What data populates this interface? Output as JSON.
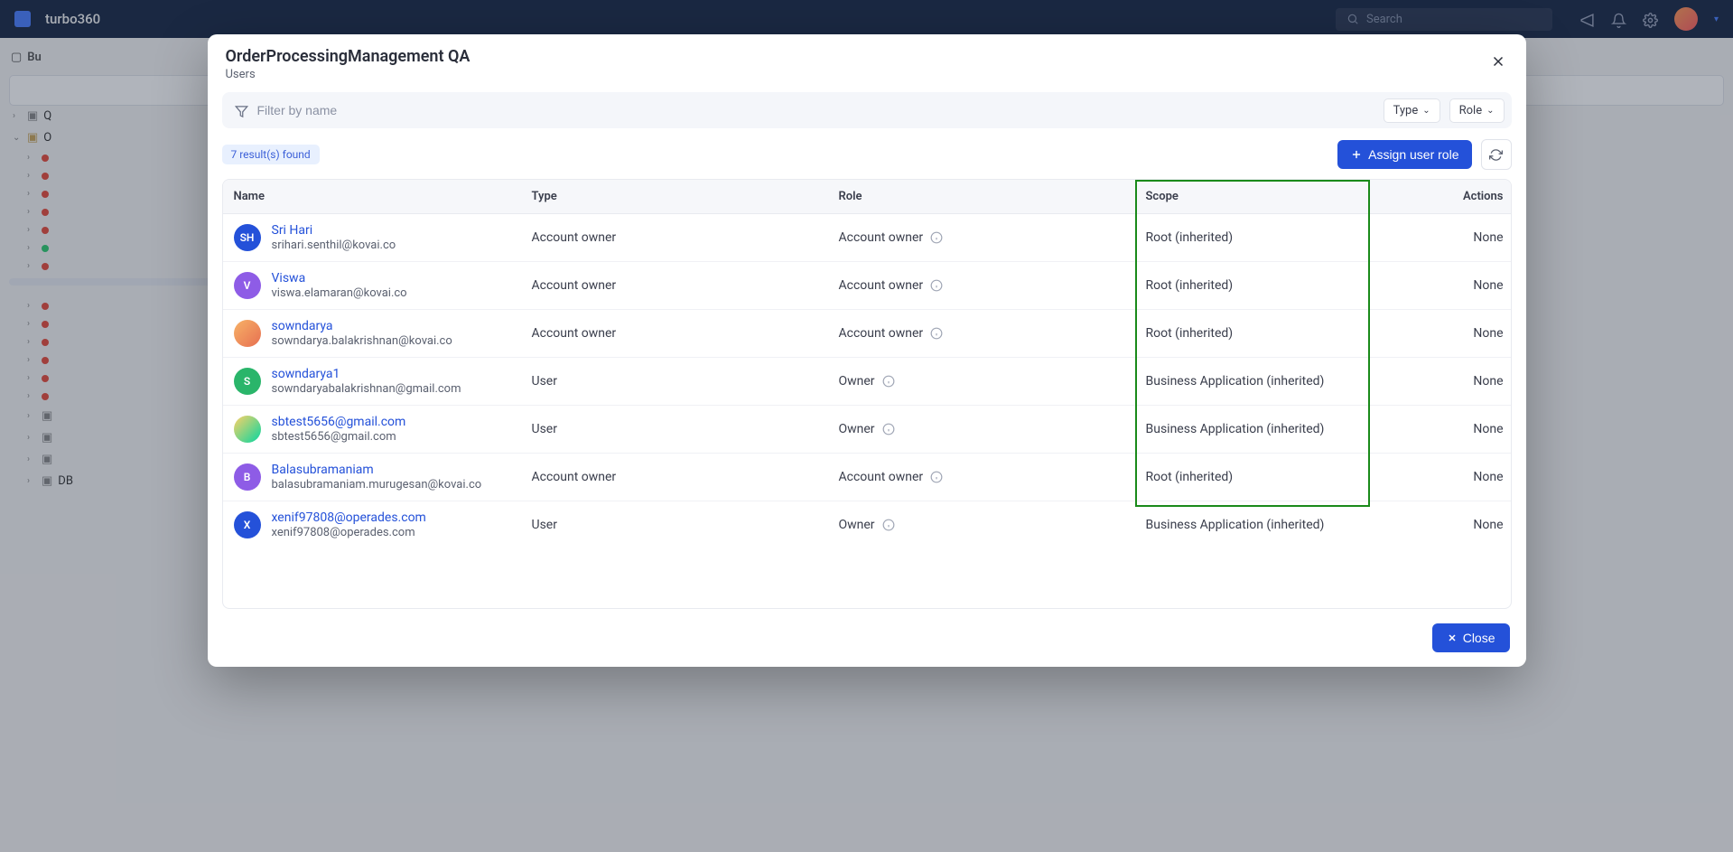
{
  "topbar": {
    "brand": "turbo360",
    "search_placeholder": "Search",
    "avatar_initials": ""
  },
  "breadcrumb": {
    "label": "Bu"
  },
  "modal": {
    "title": "OrderProcessingManagement QA",
    "subtitle": "Users",
    "filter_placeholder": "Filter by name",
    "type_dd": "Type",
    "role_dd": "Role",
    "results_badge": "7 result(s) found",
    "assign_btn": "Assign user role",
    "close_btn": "Close"
  },
  "columns": {
    "name": "Name",
    "type": "Type",
    "role": "Role",
    "scope": "Scope",
    "actions": "Actions"
  },
  "rows": [
    {
      "avatar_text": "SH",
      "avatar_bg": "#2451d9",
      "avatar_img": false,
      "name": "Sri Hari",
      "email": "srihari.senthil@kovai.co",
      "type": "Account owner",
      "role": "Account owner",
      "role_info": true,
      "scope": "Root (inherited)",
      "actions": "None"
    },
    {
      "avatar_text": "V",
      "avatar_bg": "#8e5ce6",
      "avatar_img": false,
      "name": "Viswa",
      "email": "viswa.elamaran@kovai.co",
      "type": "Account owner",
      "role": "Account owner",
      "role_info": true,
      "scope": "Root (inherited)",
      "actions": "None"
    },
    {
      "avatar_text": "",
      "avatar_bg": "",
      "avatar_img": true,
      "avatar_class": "av-img",
      "name": "sowndarya",
      "email": "sowndarya.balakrishnan@kovai.co",
      "type": "Account owner",
      "role": "Account owner",
      "role_info": true,
      "scope": "Root (inherited)",
      "actions": "None"
    },
    {
      "avatar_text": "S",
      "avatar_bg": "#2ab56a",
      "avatar_img": false,
      "name": "sowndarya1",
      "email": "sowndaryabalakrishnan@gmail.com",
      "type": "User",
      "role": "Owner",
      "role_info": true,
      "scope": "Business Application (inherited)",
      "actions": "None"
    },
    {
      "avatar_text": "",
      "avatar_bg": "",
      "avatar_img": true,
      "avatar_class": "av-img2",
      "name": "sbtest5656@gmail.com",
      "email": "sbtest5656@gmail.com",
      "type": "User",
      "role": "Owner",
      "role_info": true,
      "scope": "Business Application (inherited)",
      "actions": "None"
    },
    {
      "avatar_text": "B",
      "avatar_bg": "#8e5ce6",
      "avatar_img": false,
      "name": "Balasubramaniam",
      "email": "balasubramaniam.murugesan@kovai.co",
      "type": "Account owner",
      "role": "Account owner",
      "role_info": true,
      "scope": "Root (inherited)",
      "actions": "None"
    },
    {
      "avatar_text": "X",
      "avatar_bg": "#2451d9",
      "avatar_img": false,
      "name": "xenif97808@operades.com",
      "email": "xenif97808@operades.com",
      "type": "User",
      "role": "Owner",
      "role_info": true,
      "scope": "Business Application (inherited)",
      "actions": "None"
    }
  ],
  "sidebar_items": [
    {
      "chev": "›",
      "dot": false,
      "folder": true,
      "folder_open": false,
      "label": "Q",
      "indent": 0
    },
    {
      "chev": "⌄",
      "dot": false,
      "folder": true,
      "folder_open": true,
      "label": "O",
      "indent": 0
    },
    {
      "chev": "›",
      "dot": true,
      "color": "red",
      "label": "",
      "indent": 1
    },
    {
      "chev": "›",
      "dot": true,
      "color": "red",
      "label": "",
      "indent": 1
    },
    {
      "chev": "›",
      "dot": true,
      "color": "red",
      "label": "",
      "indent": 1
    },
    {
      "chev": "›",
      "dot": true,
      "color": "red",
      "label": "",
      "indent": 1
    },
    {
      "chev": "›",
      "dot": true,
      "color": "red",
      "label": "",
      "indent": 1
    },
    {
      "chev": "›",
      "dot": true,
      "color": "green",
      "label": "",
      "indent": 1
    },
    {
      "chev": "›",
      "dot": true,
      "color": "red",
      "label": "",
      "indent": 1
    },
    {
      "chev": "",
      "dot": false,
      "selected": true,
      "label": "",
      "indent": 1
    },
    {
      "chev": "",
      "dot": false,
      "label": "",
      "indent": 2
    },
    {
      "chev": "›",
      "dot": true,
      "color": "red",
      "label": "",
      "indent": 1
    },
    {
      "chev": "›",
      "dot": true,
      "color": "red",
      "label": "",
      "indent": 1
    },
    {
      "chev": "›",
      "dot": true,
      "color": "red",
      "label": "",
      "indent": 1
    },
    {
      "chev": "›",
      "dot": true,
      "color": "red",
      "label": "",
      "indent": 1
    },
    {
      "chev": "›",
      "dot": true,
      "color": "red",
      "label": "",
      "indent": 1
    },
    {
      "chev": "›",
      "dot": true,
      "color": "red",
      "label": "",
      "indent": 1
    },
    {
      "chev": "›",
      "dot": false,
      "folder": true,
      "label": "",
      "indent": 1
    },
    {
      "chev": "›",
      "dot": false,
      "folder": true,
      "label": "",
      "indent": 1
    },
    {
      "chev": "›",
      "dot": false,
      "folder": true,
      "label": "",
      "indent": 1
    },
    {
      "chev": "›",
      "dot": false,
      "folder": true,
      "label": "DB",
      "indent": 1
    }
  ]
}
